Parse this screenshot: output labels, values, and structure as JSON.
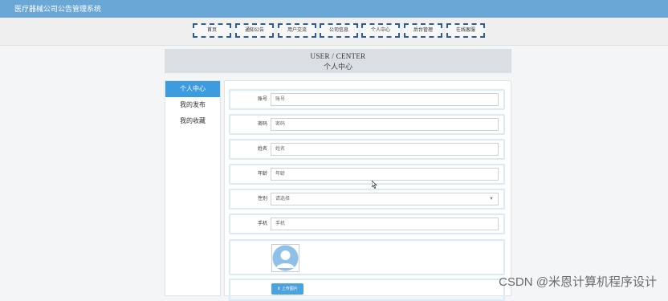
{
  "app": {
    "title": "医疗器械公司公告管理系统"
  },
  "nav": {
    "items": [
      "首页",
      "通知公告",
      "用户交流",
      "公司信息",
      "个人中心",
      "后台管理",
      "在线客服"
    ]
  },
  "panel": {
    "title_en": "USER / CENTER",
    "title_cn": "个人中心"
  },
  "sidebar": {
    "items": [
      "个人中心",
      "我的发布",
      "我的收藏"
    ],
    "active_index": 0
  },
  "form": {
    "fields": [
      {
        "label": "账号",
        "placeholder": "账号"
      },
      {
        "label": "密码",
        "placeholder": "密码"
      },
      {
        "label": "姓名",
        "placeholder": "姓名"
      },
      {
        "label": "年龄",
        "placeholder": "年龄"
      },
      {
        "label": "性别",
        "placeholder": "请选择"
      },
      {
        "label": "手机",
        "placeholder": "手机"
      }
    ],
    "upload_label": "上传图片"
  },
  "watermark": "CSDN @米恩计算机程序设计",
  "colors": {
    "topbar": "#6aa6d6",
    "accent": "#3d9be0",
    "nav_border": "#2f5d9a"
  }
}
